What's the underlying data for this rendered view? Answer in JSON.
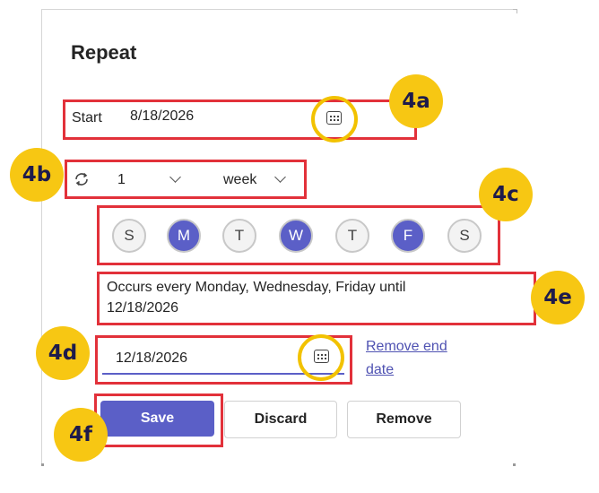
{
  "dialog": {
    "title": "Repeat",
    "start": {
      "label": "Start",
      "date": "8/18/2026"
    },
    "frequency": {
      "interval": "1",
      "unit": "week"
    },
    "days": [
      {
        "letter": "S",
        "selected": false
      },
      {
        "letter": "M",
        "selected": true
      },
      {
        "letter": "T",
        "selected": false
      },
      {
        "letter": "W",
        "selected": true
      },
      {
        "letter": "T",
        "selected": false
      },
      {
        "letter": "F",
        "selected": true
      },
      {
        "letter": "S",
        "selected": false
      }
    ],
    "summary_line1": "Occurs every Monday, Wednesday, Friday until",
    "summary_line2": "12/18/2026",
    "end": {
      "date": "12/18/2026"
    },
    "remove_end_line1": "Remove end",
    "remove_end_line2": "date",
    "buttons": {
      "save": "Save",
      "discard": "Discard",
      "remove": "Remove"
    }
  },
  "callouts": {
    "a": "4a",
    "b": "4b",
    "c": "4c",
    "d": "4d",
    "e": "4e",
    "f": "4f"
  },
  "colors": {
    "accent": "#5b5fc7",
    "annotation_red": "#e2313a",
    "callout_yellow": "#f7c713"
  }
}
